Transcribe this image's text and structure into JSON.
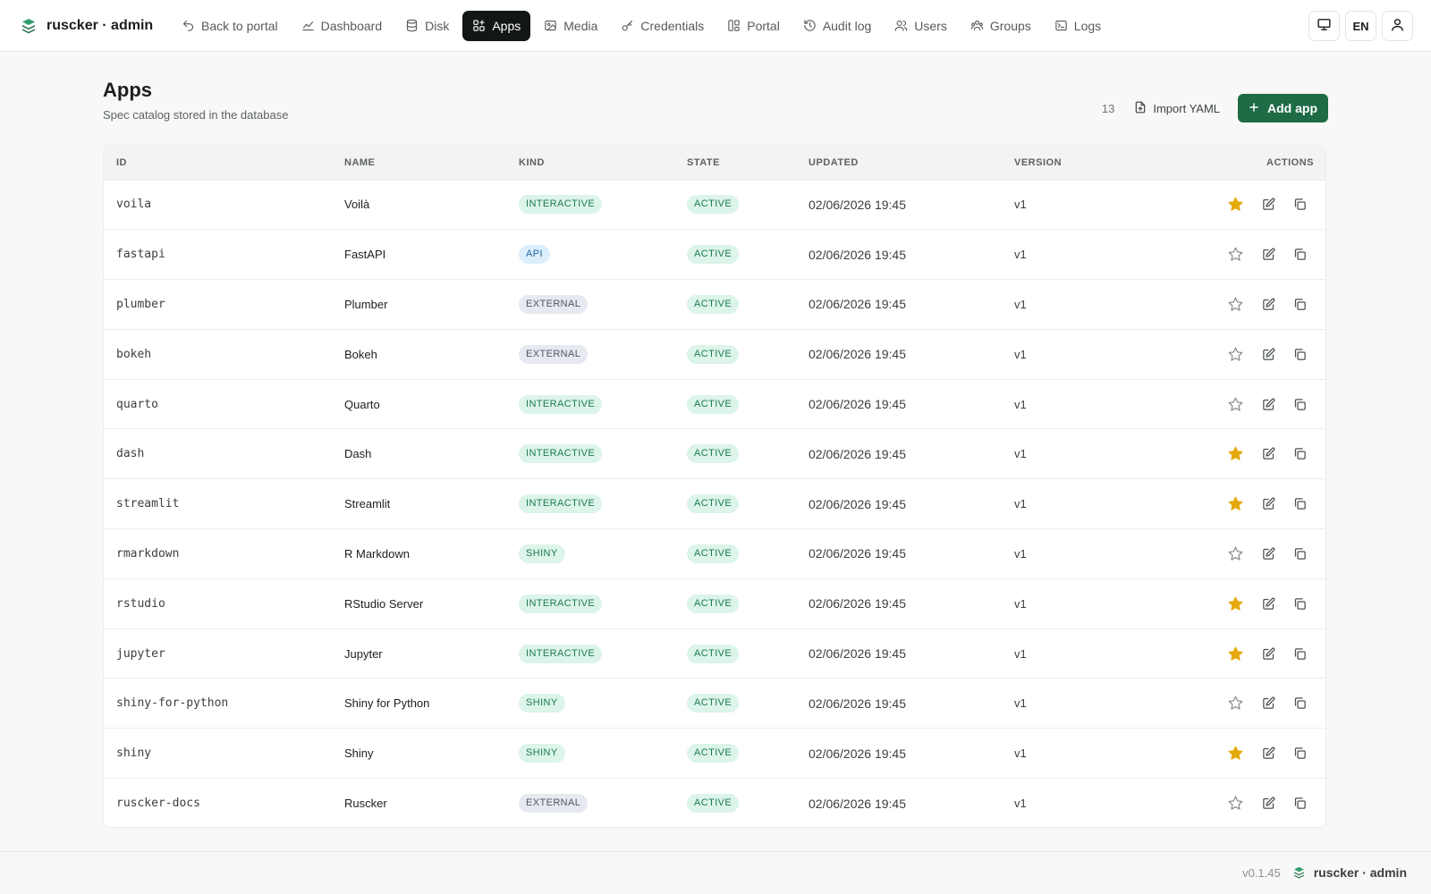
{
  "brand": {
    "name": "ruscker · admin",
    "logo_icon": "layers-icon",
    "accent": "#1e6b46"
  },
  "nav": [
    {
      "key": "back",
      "label": "Back to portal",
      "icon": "undo-arrow-icon",
      "active": false
    },
    {
      "key": "dashboard",
      "label": "Dashboard",
      "icon": "chart-line-icon",
      "active": false
    },
    {
      "key": "disk",
      "label": "Disk",
      "icon": "database-icon",
      "active": false
    },
    {
      "key": "apps",
      "label": "Apps",
      "icon": "apps-grid-icon",
      "active": true
    },
    {
      "key": "media",
      "label": "Media",
      "icon": "image-icon",
      "active": false
    },
    {
      "key": "credentials",
      "label": "Credentials",
      "icon": "key-icon",
      "active": false
    },
    {
      "key": "portal",
      "label": "Portal",
      "icon": "layout-icon",
      "active": false
    },
    {
      "key": "audit",
      "label": "Audit log",
      "icon": "history-icon",
      "active": false
    },
    {
      "key": "users",
      "label": "Users",
      "icon": "users-icon",
      "active": false
    },
    {
      "key": "groups",
      "label": "Groups",
      "icon": "groups-icon",
      "active": false
    },
    {
      "key": "logs",
      "label": "Logs",
      "icon": "terminal-icon",
      "active": false
    }
  ],
  "top_right": {
    "display_icon": "monitor-icon",
    "language": "EN",
    "user_icon": "user-icon"
  },
  "header": {
    "title": "Apps",
    "subtitle": "Spec catalog stored in the database",
    "count": "13",
    "import_label": "Import YAML",
    "add_label": "Add app"
  },
  "table": {
    "columns": [
      "ID",
      "NAME",
      "KIND",
      "STATE",
      "UPDATED",
      "VERSION",
      "ACTIONS"
    ],
    "rows": [
      {
        "id": "voila",
        "name": "Voilà",
        "kind": "INTERACTIVE",
        "state": "ACTIVE",
        "updated": "02/06/2026 19:45",
        "version": "v1",
        "starred": true
      },
      {
        "id": "fastapi",
        "name": "FastAPI",
        "kind": "API",
        "state": "ACTIVE",
        "updated": "02/06/2026 19:45",
        "version": "v1",
        "starred": false
      },
      {
        "id": "plumber",
        "name": "Plumber",
        "kind": "EXTERNAL",
        "state": "ACTIVE",
        "updated": "02/06/2026 19:45",
        "version": "v1",
        "starred": false
      },
      {
        "id": "bokeh",
        "name": "Bokeh",
        "kind": "EXTERNAL",
        "state": "ACTIVE",
        "updated": "02/06/2026 19:45",
        "version": "v1",
        "starred": false
      },
      {
        "id": "quarto",
        "name": "Quarto",
        "kind": "INTERACTIVE",
        "state": "ACTIVE",
        "updated": "02/06/2026 19:45",
        "version": "v1",
        "starred": false
      },
      {
        "id": "dash",
        "name": "Dash",
        "kind": "INTERACTIVE",
        "state": "ACTIVE",
        "updated": "02/06/2026 19:45",
        "version": "v1",
        "starred": true
      },
      {
        "id": "streamlit",
        "name": "Streamlit",
        "kind": "INTERACTIVE",
        "state": "ACTIVE",
        "updated": "02/06/2026 19:45",
        "version": "v1",
        "starred": true
      },
      {
        "id": "rmarkdown",
        "name": "R Markdown",
        "kind": "SHINY",
        "state": "ACTIVE",
        "updated": "02/06/2026 19:45",
        "version": "v1",
        "starred": false
      },
      {
        "id": "rstudio",
        "name": "RStudio Server",
        "kind": "INTERACTIVE",
        "state": "ACTIVE",
        "updated": "02/06/2026 19:45",
        "version": "v1",
        "starred": true
      },
      {
        "id": "jupyter",
        "name": "Jupyter",
        "kind": "INTERACTIVE",
        "state": "ACTIVE",
        "updated": "02/06/2026 19:45",
        "version": "v1",
        "starred": true
      },
      {
        "id": "shiny-for-python",
        "name": "Shiny for Python",
        "kind": "SHINY",
        "state": "ACTIVE",
        "updated": "02/06/2026 19:45",
        "version": "v1",
        "starred": false
      },
      {
        "id": "shiny",
        "name": "Shiny",
        "kind": "SHINY",
        "state": "ACTIVE",
        "updated": "02/06/2026 19:45",
        "version": "v1",
        "starred": true
      },
      {
        "id": "ruscker-docs",
        "name": "Ruscker",
        "kind": "EXTERNAL",
        "state": "ACTIVE",
        "updated": "02/06/2026 19:45",
        "version": "v1",
        "starred": false
      }
    ]
  },
  "colors": {
    "star_on": "#e5a90b",
    "star_off": "#8a8f8c",
    "active_nav": "#121614"
  },
  "footer": {
    "version": "v0.1.45",
    "brand": "ruscker · admin"
  }
}
